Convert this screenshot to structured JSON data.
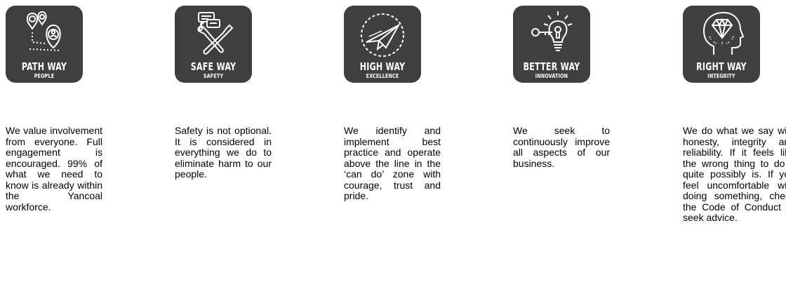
{
  "values": [
    {
      "title": "PATH WAY",
      "subtitle": "PEOPLE",
      "icon": "location-pin-path-icon",
      "description": "We value involvement from everyone. Full engagement is encouraged. 99% of what we need to know is already within the Yancoal workforce."
    },
    {
      "title": "SAFE WAY",
      "subtitle": "SAFETY",
      "icon": "tools-chat-icon",
      "description": "Safety is not optional. It is considered in everything we do to eliminate harm to our people."
    },
    {
      "title": "HIGH WAY",
      "subtitle": "EXCELLENCE",
      "icon": "paper-plane-icon",
      "description": "We identify and implement best practice and operate above the line in the ‘can do’ zone with courage, trust and pride."
    },
    {
      "title": "BETTER WAY",
      "subtitle": "INNOVATION",
      "icon": "lightbulb-key-icon",
      "description": "We seek to continuously improve all aspects of our business."
    },
    {
      "title": "RIGHT WAY",
      "subtitle": "INTEGRITY",
      "icon": "diamond-head-icon",
      "description": "We do what we say with honesty, integrity and reliability. If it feels like the wrong thing to do it quite possibly is. If you feel uncomfortable with doing something, check the Code of Conduct or seek advice."
    }
  ],
  "colors": {
    "card_bg": "#3f3f3f",
    "icon_fg": "#ffffff",
    "text": "#000000"
  }
}
